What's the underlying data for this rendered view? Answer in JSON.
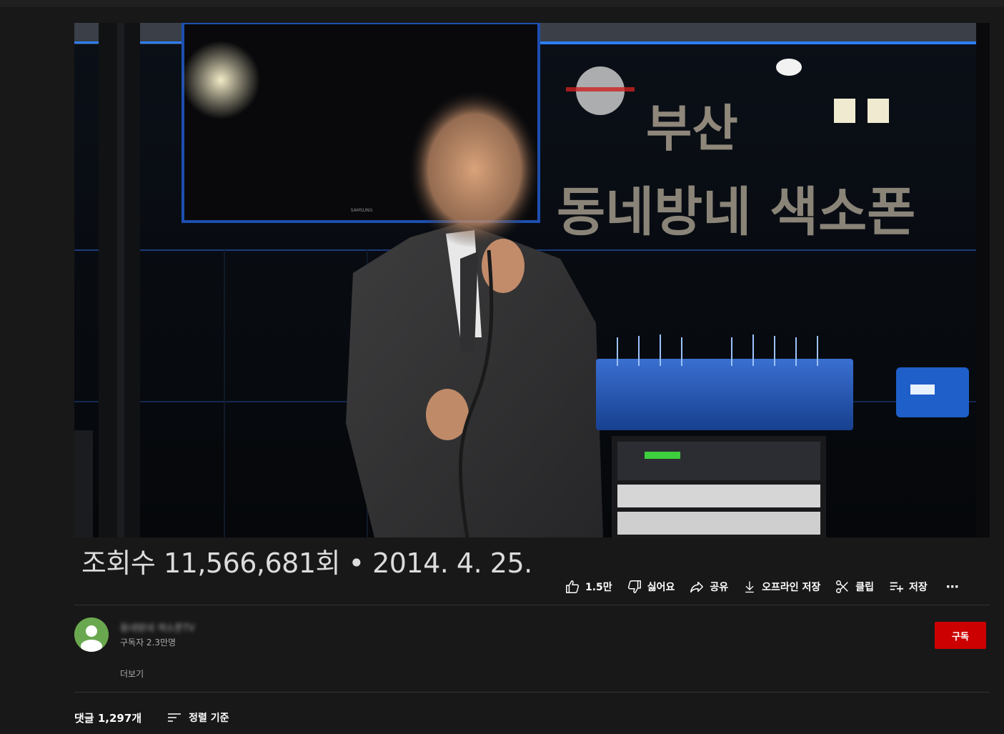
{
  "video": {
    "scene_sign_line1": "부산",
    "scene_sign_line2": "동네방네 색소폰",
    "tv_brand": "SAMSUNG"
  },
  "info": {
    "views_and_date": "조회수 11,566,681회 • 2014. 4. 25."
  },
  "actions": {
    "like_count": "1.5만",
    "dislike_label": "싫어요",
    "share_label": "공유",
    "download_label": "오프라인 저장",
    "clip_label": "클립",
    "save_label": "저장",
    "more_label": "⋯"
  },
  "channel": {
    "name": "동네방네 색소폰TV",
    "subscribers": "구독자 2.3만명",
    "subscribe_label": "구독"
  },
  "description": {
    "more_label": "더보기"
  },
  "comments": {
    "count_label": "댓글 1,297개",
    "sort_label": "정렬 기준"
  },
  "colors": {
    "background": "#181818",
    "subscribe": "#cc0000",
    "avatar": "#6aa84f"
  }
}
